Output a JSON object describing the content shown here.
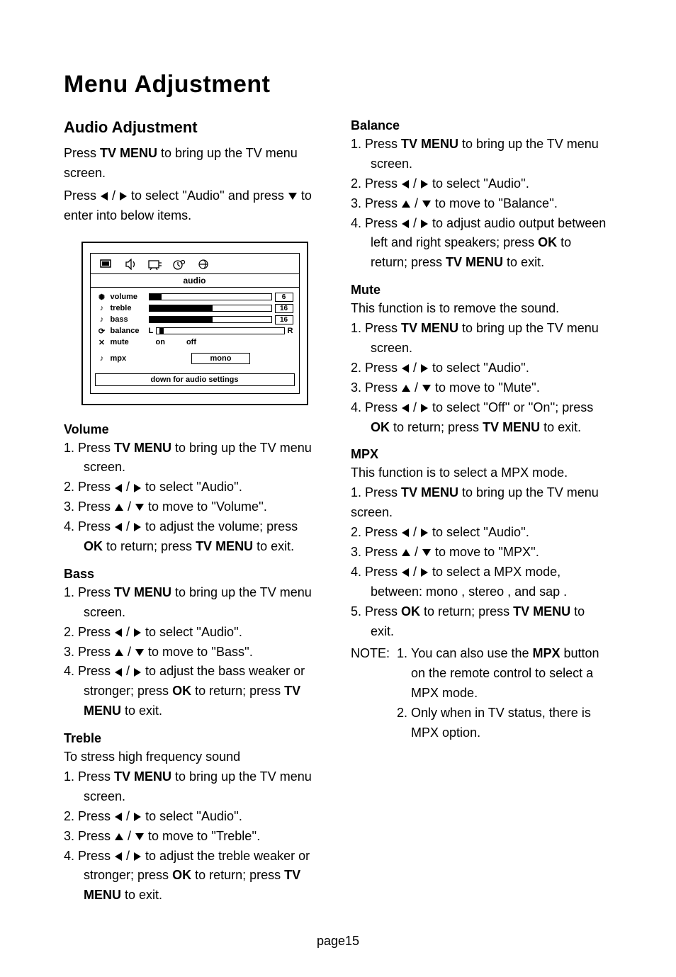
{
  "page_title": "Menu Adjustment",
  "page_footer": "page15",
  "left": {
    "section_title": "Audio Adjustment",
    "intro_a": "Press  ",
    "intro_key": "TV MENU",
    "intro_b": "  to bring up the TV menu screen.",
    "intro2_a": "Press ",
    "intro2_b": " to select ''Audio'' and press ",
    "intro2_c": " to enter into below items.",
    "osd": {
      "title": "audio",
      "rows": {
        "volume": {
          "label": "volume",
          "value": "6",
          "fill": 10
        },
        "treble": {
          "label": "treble",
          "value": "16",
          "fill": 52
        },
        "bass": {
          "label": "bass",
          "value": "16",
          "fill": 52
        },
        "balance": {
          "label": "balance",
          "left": "L",
          "right": "R",
          "pos": 8
        },
        "mute": {
          "label": "mute",
          "opt1": "on",
          "opt2": "off"
        },
        "mpx": {
          "label": "mpx",
          "value": "mono"
        }
      },
      "footer": "down for audio settings"
    },
    "volume": {
      "title": "Volume",
      "s1a": "1. Press  ",
      "s1k": "TV MENU",
      "s1b": "  to bring up the TV menu",
      "s1c": "screen.",
      "s2a": "2. Press ",
      "s2b": " to select ''Audio''.",
      "s3a": "3. Press ",
      "s3b": " to move to ''Volume''.",
      "s4a": "4. Press ",
      "s4b": " to adjust the volume; press",
      "s4c_a": "",
      "s4c_k": "OK",
      "s4c_b": "  to return; press  ",
      "s4c_k2": "TV MENU",
      "s4c_c": "  to exit."
    },
    "bass": {
      "title": "Bass",
      "s1a": "1. Press  ",
      "s1k": "TV MENU",
      "s1b": "  to bring up the TV menu",
      "s1c": "screen.",
      "s2a": "2. Press ",
      "s2b": " to select ''Audio''.",
      "s3a": "3. Press  ",
      "s3b": " to move to ''Bass''.",
      "s4a": "4. Press ",
      "s4b": " to adjust the bass weaker or",
      "s4c_a": "stronger; press  ",
      "s4c_k": "OK",
      "s4c_b": "  to return; press  ",
      "s4c_k2": "TV",
      "s4d_k": "MENU",
      "s4d_b": "  to exit."
    },
    "treble": {
      "title": "Treble",
      "desc": "To stress high frequency sound",
      "s1a": "1. Press  ",
      "s1k": "TV MENU",
      "s1b": "  to bring up the TV menu",
      "s1c": "screen.",
      "s2a": "2. Press ",
      "s2b": "to select ''Audio''.",
      "s3a": "3. Press  ",
      "s3b": " to move to ''Treble''.",
      "s4a": "4. Press ",
      "s4b": " to adjust the treble weaker or",
      "s4c_a": "stronger; press  ",
      "s4c_k": "OK",
      "s4c_b": "  to return; press  ",
      "s4c_k2": "TV",
      "s4d_k": "MENU",
      "s4d_b": "  to exit."
    }
  },
  "right": {
    "balance": {
      "title": "Balance",
      "s1a": "1. Press  ",
      "s1k": "TV MENU",
      "s1b": "  to bring up the TV menu",
      "s1c": "screen.",
      "s2a": "2. Press ",
      "s2b": " to select ''Audio''.",
      "s3a": "3. Press  ",
      "s3b": " to move to ''Balance''.",
      "s4a": "4. Press ",
      "s4b": " to adjust audio output between",
      "s4c_a": "left and right speakers; press  ",
      "s4c_k": "OK",
      "s4c_b": "  to",
      "s4d_a": "return; press  ",
      "s4d_k": "TV MENU",
      "s4d_b": "  to exit."
    },
    "mute": {
      "title": "Mute",
      "desc": "This function is to remove the sound.",
      "s1a": "1. Press  ",
      "s1k": "TV MENU",
      "s1b": "  to bring up the TV menu",
      "s1c": "screen.",
      "s2a": "2. Press ",
      "s2b": " to select ''Audio''.",
      "s3a": "3. Press  ",
      "s3b": " to move to ''Mute''.",
      "s4a": "4. Press ",
      "s4b": " to select ''Off'' or ''On''; press",
      "s4c_k": "OK",
      "s4c_b": "  to return; press  ",
      "s4c_k2": "TV MENU",
      "s4c_c": "  to exit."
    },
    "mpx": {
      "title": "MPX",
      "desc": "This function is to select a MPX mode.",
      "s1a": "1. Press  ",
      "s1k": "TV MENU",
      "s1b": "  to bring up the TV menu",
      "s1c": "screen.",
      "s2a": "2. Press ",
      "s2b": " to select ''Audio''.",
      "s3a": "3. Press  ",
      "s3b": " to move to ''MPX''.",
      "s4a": "4. Press ",
      "s4b": " to select a MPX mode,",
      "s4c": "between:  mono ,  stereo , and  sap .",
      "s5a": "5. Press  ",
      "s5k": "OK",
      "s5b": "  to return; press  ",
      "s5k2": "TV MENU",
      "s5c": "  to",
      "s5d": "exit.",
      "note_label": "NOTE:  ",
      "note1_num": "1. ",
      "note1a": "You can also use the  ",
      "note1k": "MPX",
      "note1b": "  button",
      "note1c": "on the remote control to select a",
      "note1d": "MPX mode.",
      "note2_num": "2. ",
      "note2a": "Only when in TV status, there is",
      "note2b": "MPX  option."
    }
  }
}
